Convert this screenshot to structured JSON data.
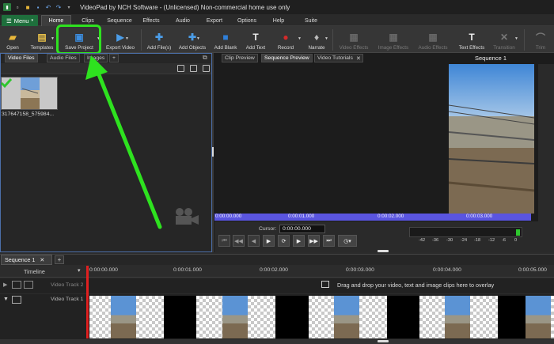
{
  "window": {
    "title": "VideoPad by NCH Software - (Unlicensed) Non-commercial home use only"
  },
  "menu": {
    "label": "Menu"
  },
  "tabs": [
    "Home",
    "Clips",
    "Sequence",
    "Effects",
    "Audio",
    "Export",
    "Options",
    "Help",
    "Suite"
  ],
  "toolbar": {
    "open": "Open",
    "templates": "Templates",
    "save_project": "Save Project",
    "export_video": "Export Video",
    "add_files": "Add File(s)",
    "add_objects": "Add Objects",
    "add_blank": "Add Blank",
    "add_text": "Add Text",
    "record": "Record",
    "narrate": "Narrate",
    "video_effects": "Video Effects",
    "image_effects": "Image Effects",
    "audio_effects": "Audio Effects",
    "text_effects": "Text Effects",
    "transition": "Transition",
    "trim": "Trim"
  },
  "media_tabs": {
    "video": "Video Files",
    "audio": "Audio Files",
    "images": "Images",
    "add": "+"
  },
  "clip": {
    "name": "317647158_575984..."
  },
  "preview_tabs": {
    "clip": "Clip Preview",
    "sequence": "Sequence Preview",
    "tutorials": "Video Tutorials"
  },
  "preview": {
    "title": "Sequence 1"
  },
  "ruler": [
    "0:00:00.000",
    "0:00:01.000",
    "0:00:02.000",
    "0:00:03.000"
  ],
  "cursor": {
    "label": "Cursor:",
    "value": "0:00:00.000"
  },
  "meter": [
    "-42",
    "-36",
    "-30",
    "-24",
    "-18",
    "-12",
    "-6",
    "0"
  ],
  "timeline": {
    "sequence_tab": "Sequence 1",
    "label": "Timeline",
    "times": [
      "0:00:00.000",
      "0:00:01.000",
      "0:00:02.000",
      "0:00:03.000",
      "0:00:04.000",
      "0:00:05.000"
    ],
    "track2": "Video Track 2",
    "track1": "Video Track 1",
    "drop_message": "Drag and drop your video, text and image clips here to overlay"
  },
  "colors": {
    "accent": "#1e6f3c",
    "highlight": "#2ee21f",
    "ruler": "#5a55e0",
    "playhead": "#e02020"
  }
}
